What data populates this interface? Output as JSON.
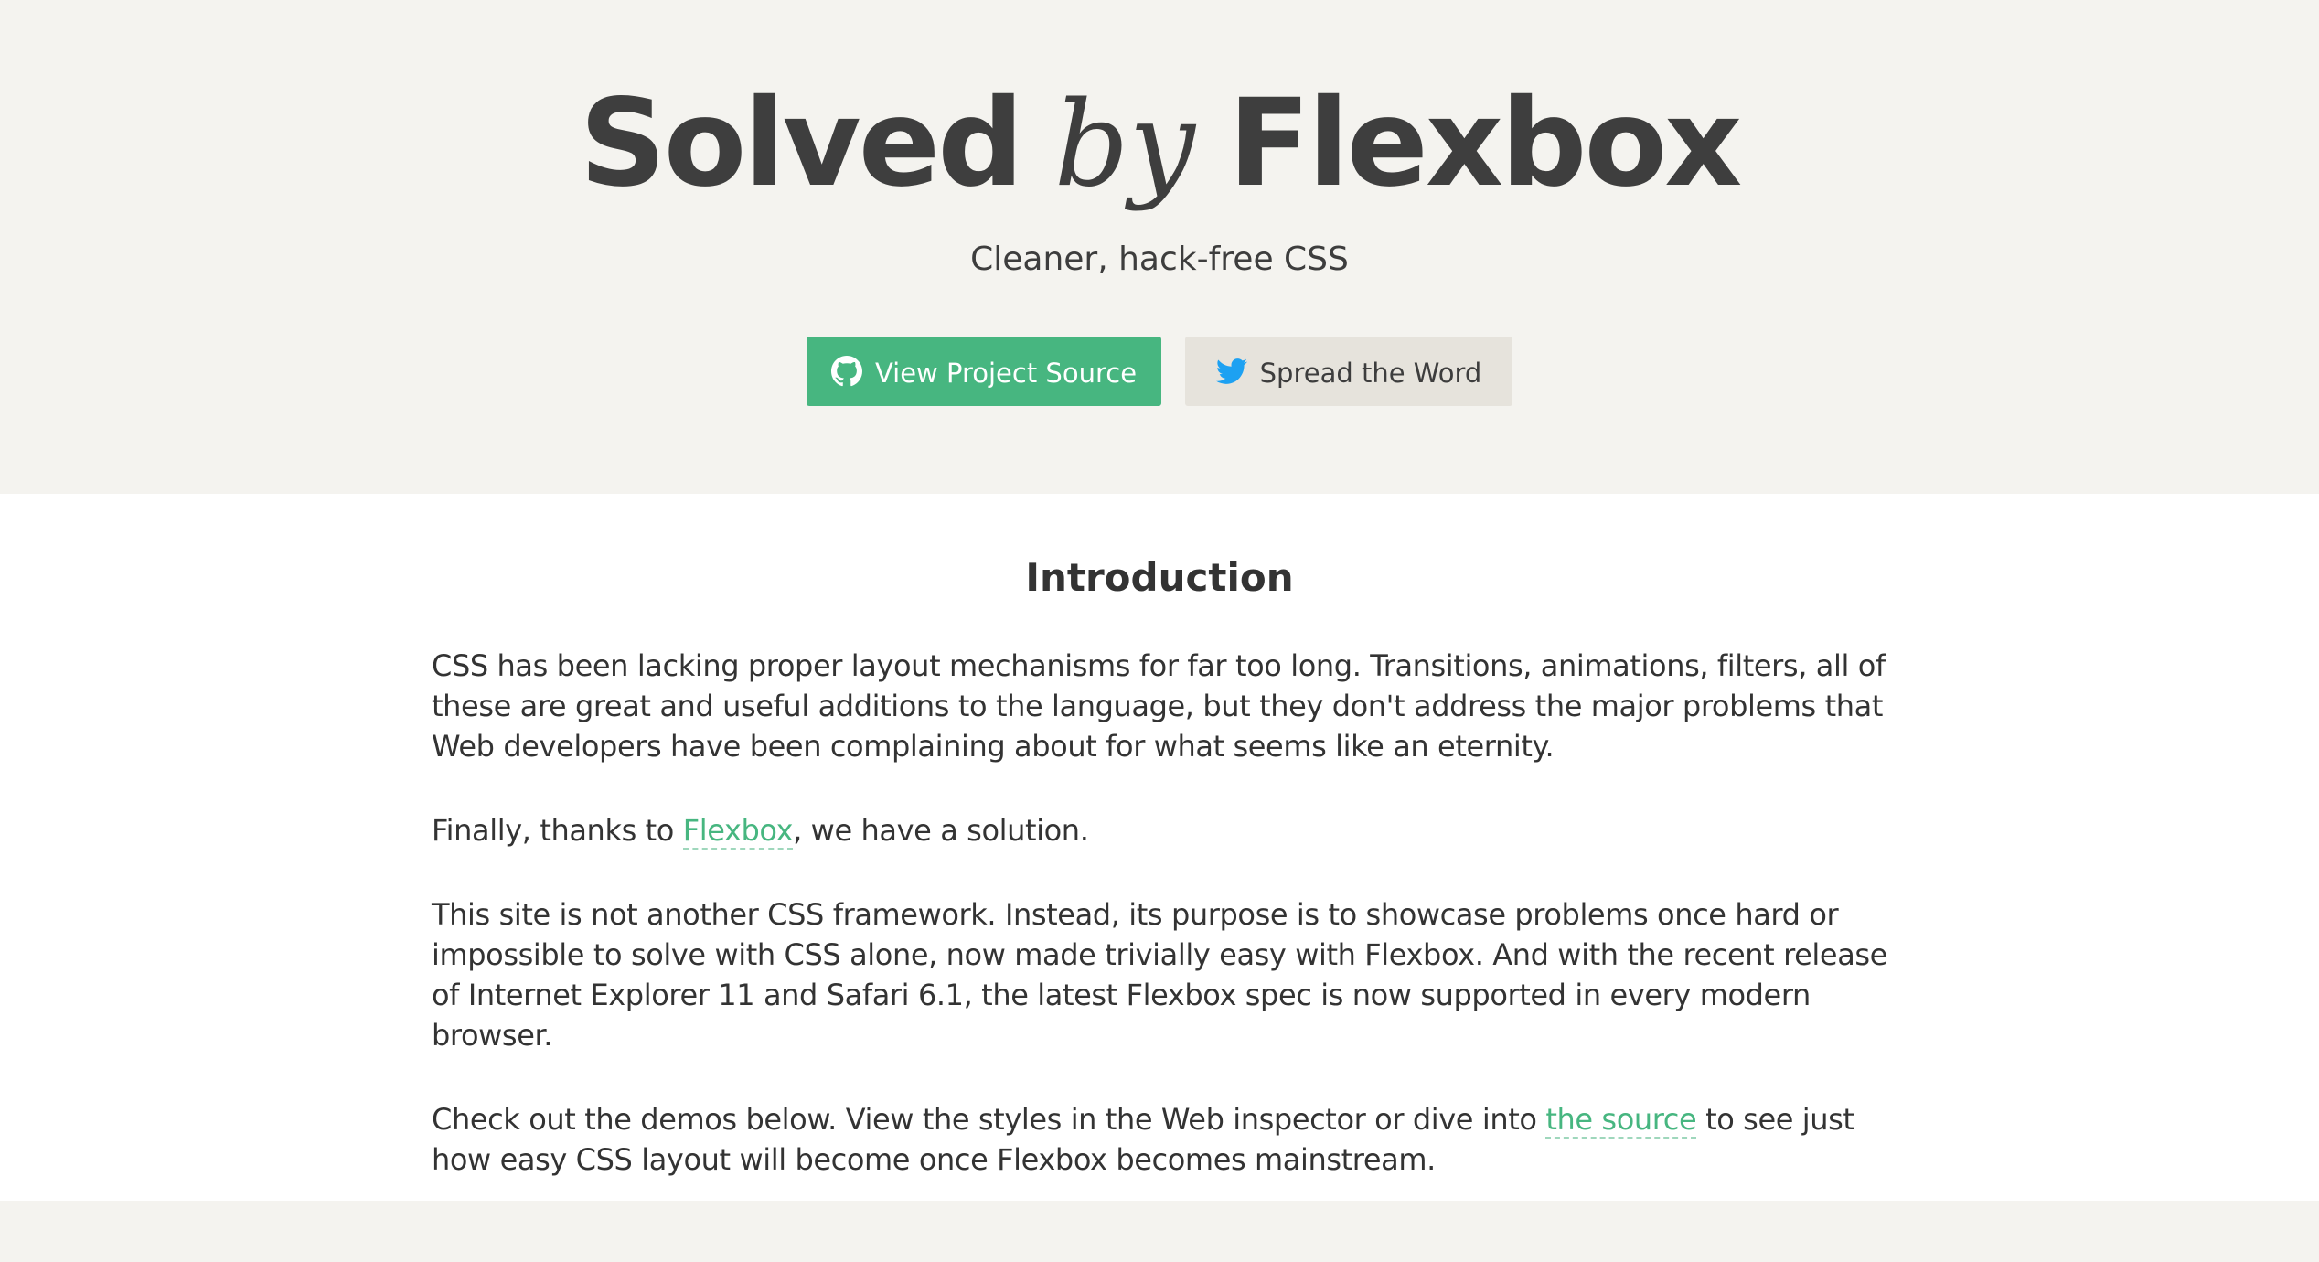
{
  "header": {
    "title_part1": "Solved",
    "title_by": "by",
    "title_part2": "Flexbox",
    "tagline": "Cleaner, hack-free CSS",
    "buttons": [
      {
        "label": "View Project Source",
        "icon": "github-icon"
      },
      {
        "label": "Spread the Word",
        "icon": "twitter-icon"
      }
    ]
  },
  "intro": {
    "heading": "Introduction",
    "p1": "CSS has been lacking proper layout mechanisms for far too long. Transitions, animations, filters, all of these are great and useful additions to the language, but they don't address the major problems that Web developers have been complaining about for what seems like an eternity.",
    "p2_before": "Finally, thanks to ",
    "p2_link": "Flexbox",
    "p2_after": ", we have a solution.",
    "p3": "This site is not another CSS framework. Instead, its purpose is to showcase problems once hard or impossible to solve with CSS alone, now made trivially easy with Flexbox. And with the recent release of Internet Explorer 11 and Safari 6.1, the latest Flexbox spec is now supported in every modern browser.",
    "p4_before": "Check out the demos below. View the styles in the Web inspector or dive into ",
    "p4_link": "the source",
    "p4_after": " to see just how easy CSS layout will become once Flexbox becomes mainstream."
  },
  "colors": {
    "accent": "#47b680",
    "header_bg": "#f4f3ef",
    "secondary_button_bg": "#e6e3dc",
    "twitter_blue": "#1da1f2"
  }
}
